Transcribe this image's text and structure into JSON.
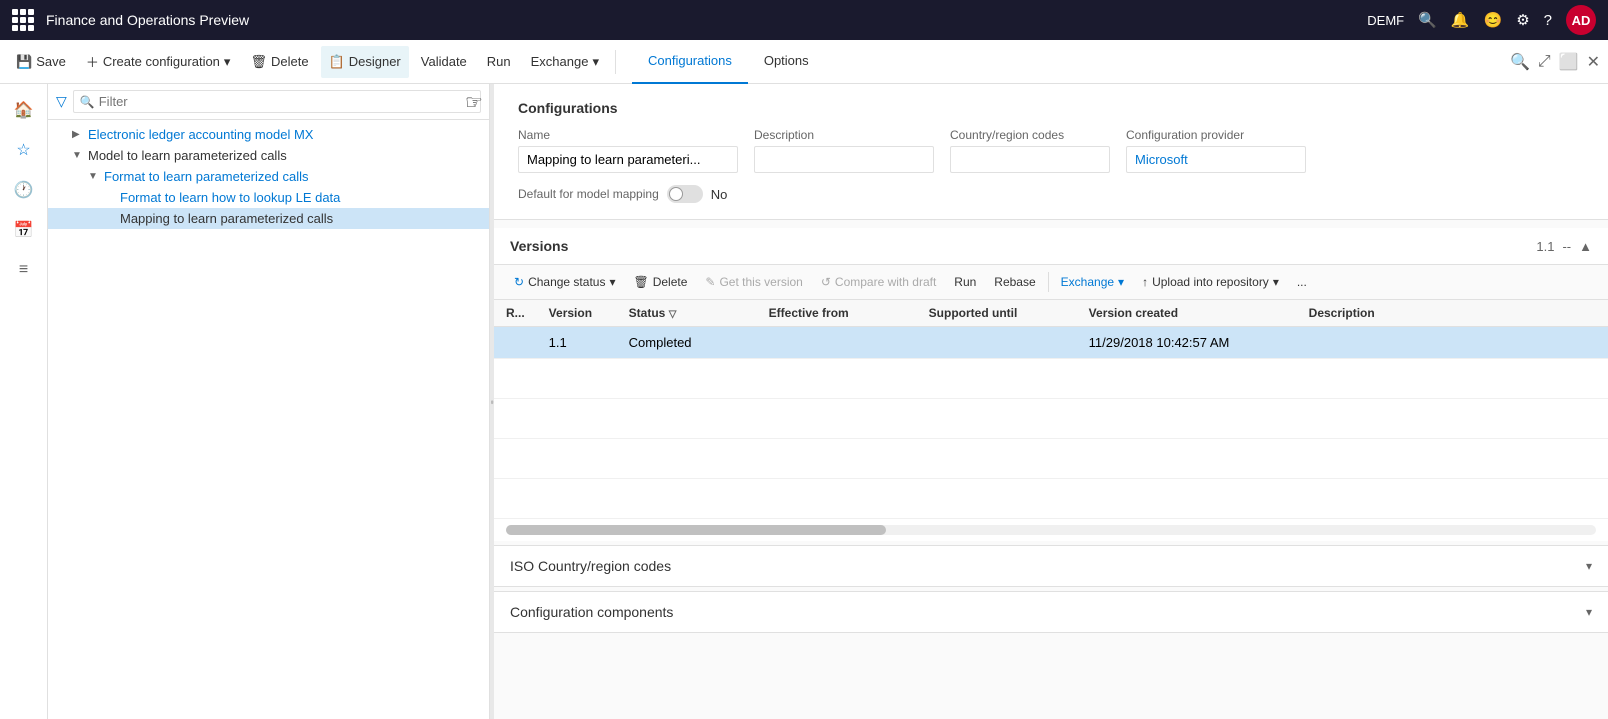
{
  "titleBar": {
    "appName": "Finance and Operations Preview",
    "user": "AD",
    "userCode": "DEMF",
    "icons": [
      "search",
      "bell",
      "smiley",
      "gear",
      "help",
      "user"
    ]
  },
  "toolbar": {
    "saveLabel": "Save",
    "createConfigLabel": "Create configuration",
    "deleteLabel": "Delete",
    "designerLabel": "Designer",
    "validateLabel": "Validate",
    "runLabel": "Run",
    "exchangeLabel": "Exchange",
    "tabs": [
      "Configurations",
      "Options"
    ],
    "activeTab": "Configurations"
  },
  "nav": {
    "icons": [
      "home",
      "star",
      "clock",
      "calendar",
      "list"
    ]
  },
  "filter": {
    "placeholder": "Filter"
  },
  "tree": {
    "items": [
      {
        "label": "Electronic ledger accounting model MX",
        "indent": 1,
        "collapsed": true,
        "isLink": true
      },
      {
        "label": "Model to learn parameterized calls",
        "indent": 1,
        "collapsed": false,
        "isLink": false
      },
      {
        "label": "Format to learn parameterized calls",
        "indent": 2,
        "collapsed": false,
        "isLink": true
      },
      {
        "label": "Format to learn how to lookup LE data",
        "indent": 3,
        "isLink": true
      },
      {
        "label": "Mapping to learn parameterized calls",
        "indent": 3,
        "isLink": true,
        "selected": true
      }
    ]
  },
  "configForm": {
    "sectionTitle": "Configurations",
    "nameLabel": "Name",
    "nameValue": "Mapping to learn parameteri...",
    "descLabel": "Description",
    "descValue": "",
    "countryLabel": "Country/region codes",
    "countryValue": "",
    "providerLabel": "Configuration provider",
    "providerValue": "Microsoft",
    "toggleLabel": "Default for model mapping",
    "toggleValue": "No"
  },
  "versions": {
    "sectionTitle": "Versions",
    "versionNumber": "1.1",
    "toolbar": {
      "changeStatus": "Change status",
      "delete": "Delete",
      "getThisVersion": "Get this version",
      "compareWithDraft": "Compare with draft",
      "run": "Run",
      "rebase": "Rebase",
      "exchange": "Exchange",
      "uploadIntoRepository": "Upload into repository",
      "more": "..."
    },
    "columns": [
      "R...",
      "Version",
      "Status",
      "Effective from",
      "Supported until",
      "Version created",
      "Description"
    ],
    "rows": [
      {
        "r": "",
        "version": "1.1",
        "status": "Completed",
        "effectiveFrom": "",
        "supportedUntil": "",
        "versionCreated": "11/29/2018 10:42:57 AM",
        "description": ""
      }
    ]
  },
  "isoSection": {
    "title": "ISO Country/region codes"
  },
  "configComponentsSection": {
    "title": "Configuration components"
  }
}
